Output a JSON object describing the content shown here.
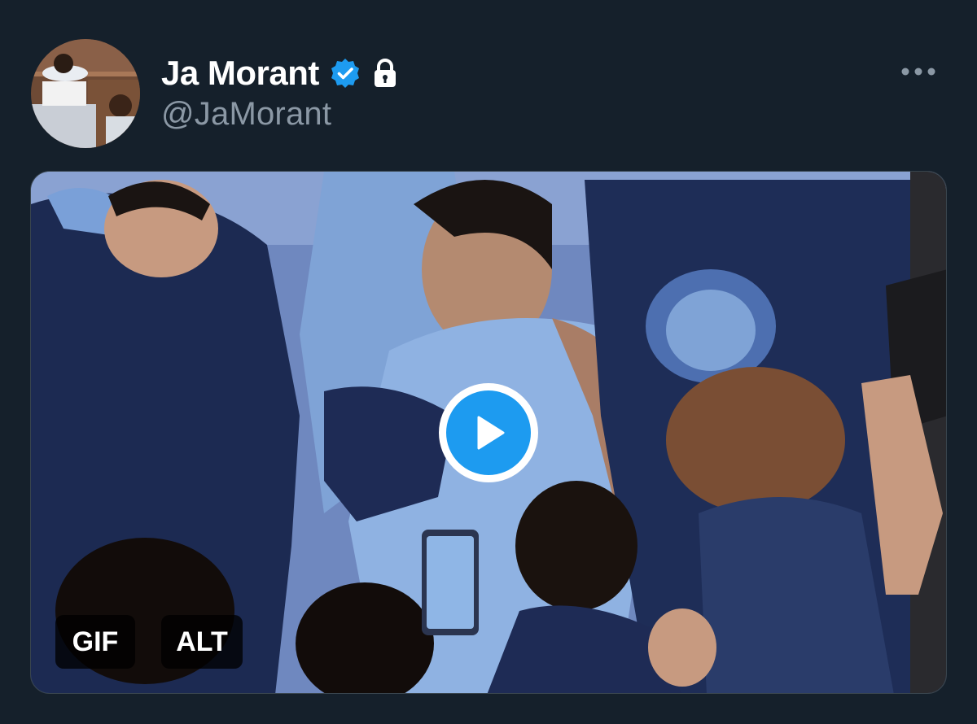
{
  "user": {
    "display_name": "Ja Morant",
    "handle": "@JaMorant",
    "verified": true,
    "protected": true,
    "icons": [
      "verified-badge-icon",
      "lock-icon"
    ]
  },
  "actions": {
    "more_icon": "more-horizontal-icon"
  },
  "media": {
    "type": "gif",
    "gif_label": "GIF",
    "alt_label": "ALT",
    "play_icon": "play-icon"
  },
  "colors": {
    "background": "#15202b",
    "handle_text": "#8b98a5",
    "accent": "#1d9bf0",
    "verified": "#1d9bf0"
  }
}
